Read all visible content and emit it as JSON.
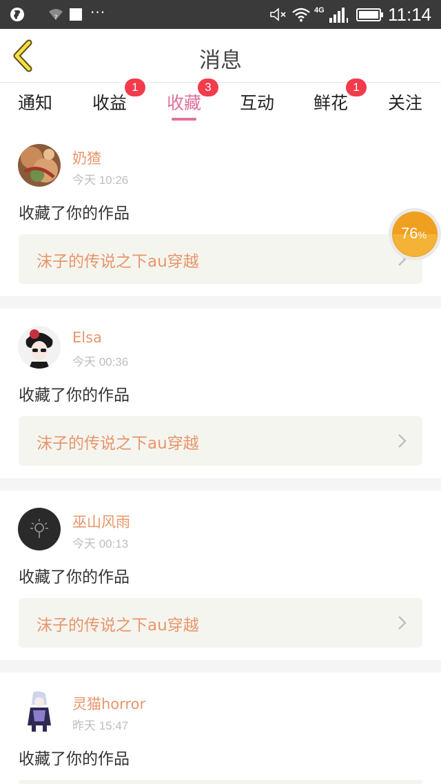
{
  "status_bar": {
    "network": "4G",
    "time": "11:14",
    "more": "···"
  },
  "header": {
    "title": "消息"
  },
  "tabs": [
    {
      "label": "通知",
      "badge": null
    },
    {
      "label": "收益",
      "badge": "1"
    },
    {
      "label": "收藏",
      "badge": "3",
      "active": true
    },
    {
      "label": "互动",
      "badge": null
    },
    {
      "label": "鲜花",
      "badge": "1"
    },
    {
      "label": "关注",
      "badge": null
    }
  ],
  "feed": [
    {
      "user": "奶猹",
      "time": "今天 10:26",
      "action": "收藏了你的作品",
      "work_title": "沫子的传说之下au穿越"
    },
    {
      "user": "Elsa",
      "time": "今天 00:36",
      "action": "收藏了你的作品",
      "work_title": "沫子的传说之下au穿越"
    },
    {
      "user": "巫山风雨",
      "time": "今天 00:13",
      "action": "收藏了你的作品",
      "work_title": "沫子的传说之下au穿越"
    },
    {
      "user": "灵猫horror",
      "time": "昨天 15:47",
      "action": "收藏了你的作品",
      "work_title": ""
    }
  ],
  "floating_progress": {
    "value": "76",
    "unit": "%",
    "percent": 76
  },
  "colors": {
    "status_bar_bg": "#3a3a3a",
    "accent_pink": "#e0709c",
    "badge_red": "#f23b4b",
    "username_orange": "#e8956a",
    "work_box_bg": "#f5f5ef",
    "progress_orange": "#f0a020"
  },
  "icons": [
    "globe-icon",
    "wifi-unknown-icon",
    "mute-icon",
    "wifi-icon",
    "signal-icon",
    "battery-icon",
    "back-chevron-icon",
    "chevron-right-icon"
  ]
}
